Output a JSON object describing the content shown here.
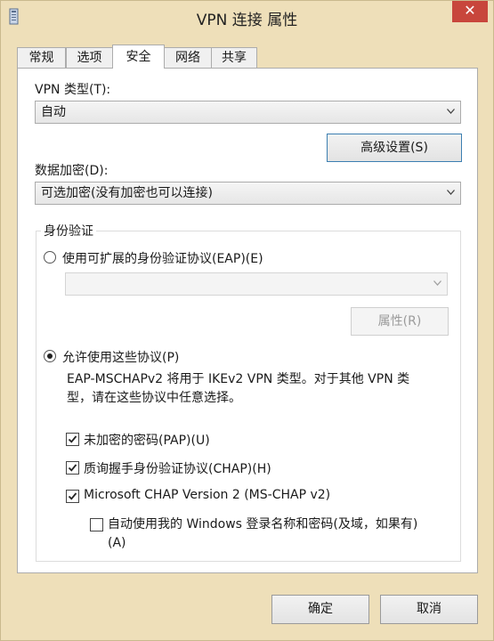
{
  "window": {
    "title": "VPN 连接 属性",
    "close_glyph": "✕"
  },
  "tabs": [
    {
      "label": "常规"
    },
    {
      "label": "选项"
    },
    {
      "label": "安全",
      "active": true
    },
    {
      "label": "网络"
    },
    {
      "label": "共享"
    }
  ],
  "security": {
    "vpn_type_label": "VPN 类型(T):",
    "vpn_type_value": "自动",
    "advanced_button": "高级设置(S)",
    "encryption_label": "数据加密(D):",
    "encryption_value": "可选加密(没有加密也可以连接)",
    "auth": {
      "group_title": "身份验证",
      "eap_radio_label": "使用可扩展的身份验证协议(EAP)(E)",
      "eap_radio_selected": false,
      "eap_combo_value": "",
      "properties_button": "属性(R)",
      "allow_radio_label": "允许使用这些协议(P)",
      "allow_radio_selected": true,
      "description_line1": "EAP-MSCHAPv2 将用于 IKEv2 VPN 类型。对于其他 VPN 类",
      "description_line2": "型，请在这些协议中任意选择。",
      "protocols": [
        {
          "label": "未加密的密码(PAP)(U)",
          "checked": true
        },
        {
          "label": "质询握手身份验证协议(CHAP)(H)",
          "checked": true
        },
        {
          "label": "Microsoft CHAP Version 2 (MS-CHAP v2)",
          "checked": true
        }
      ],
      "auto_windows_login_line1": "自动使用我的 Windows 登录名称和密码(及域，如果有)",
      "auto_windows_login_line2": "(A)",
      "auto_windows_login_checked": false
    }
  },
  "footer": {
    "ok_button": "确定",
    "cancel_button": "取消"
  },
  "icons": {
    "app": "vpn-connection-icon",
    "dropdown": "chevron-down-icon",
    "check": "checkmark-icon",
    "close": "close-icon"
  }
}
